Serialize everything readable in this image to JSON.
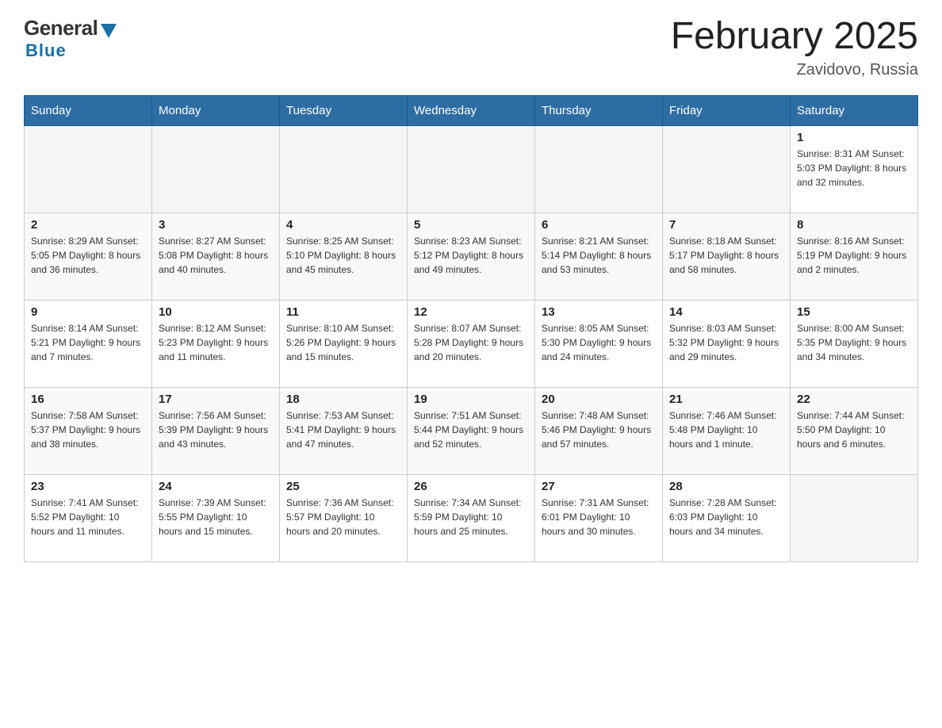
{
  "header": {
    "logo_general": "General",
    "logo_blue": "Blue",
    "month_title": "February 2025",
    "location": "Zavidovo, Russia"
  },
  "weekdays": [
    "Sunday",
    "Monday",
    "Tuesday",
    "Wednesday",
    "Thursday",
    "Friday",
    "Saturday"
  ],
  "weeks": [
    [
      {
        "day": "",
        "info": ""
      },
      {
        "day": "",
        "info": ""
      },
      {
        "day": "",
        "info": ""
      },
      {
        "day": "",
        "info": ""
      },
      {
        "day": "",
        "info": ""
      },
      {
        "day": "",
        "info": ""
      },
      {
        "day": "1",
        "info": "Sunrise: 8:31 AM\nSunset: 5:03 PM\nDaylight: 8 hours and 32 minutes."
      }
    ],
    [
      {
        "day": "2",
        "info": "Sunrise: 8:29 AM\nSunset: 5:05 PM\nDaylight: 8 hours and 36 minutes."
      },
      {
        "day": "3",
        "info": "Sunrise: 8:27 AM\nSunset: 5:08 PM\nDaylight: 8 hours and 40 minutes."
      },
      {
        "day": "4",
        "info": "Sunrise: 8:25 AM\nSunset: 5:10 PM\nDaylight: 8 hours and 45 minutes."
      },
      {
        "day": "5",
        "info": "Sunrise: 8:23 AM\nSunset: 5:12 PM\nDaylight: 8 hours and 49 minutes."
      },
      {
        "day": "6",
        "info": "Sunrise: 8:21 AM\nSunset: 5:14 PM\nDaylight: 8 hours and 53 minutes."
      },
      {
        "day": "7",
        "info": "Sunrise: 8:18 AM\nSunset: 5:17 PM\nDaylight: 8 hours and 58 minutes."
      },
      {
        "day": "8",
        "info": "Sunrise: 8:16 AM\nSunset: 5:19 PM\nDaylight: 9 hours and 2 minutes."
      }
    ],
    [
      {
        "day": "9",
        "info": "Sunrise: 8:14 AM\nSunset: 5:21 PM\nDaylight: 9 hours and 7 minutes."
      },
      {
        "day": "10",
        "info": "Sunrise: 8:12 AM\nSunset: 5:23 PM\nDaylight: 9 hours and 11 minutes."
      },
      {
        "day": "11",
        "info": "Sunrise: 8:10 AM\nSunset: 5:26 PM\nDaylight: 9 hours and 15 minutes."
      },
      {
        "day": "12",
        "info": "Sunrise: 8:07 AM\nSunset: 5:28 PM\nDaylight: 9 hours and 20 minutes."
      },
      {
        "day": "13",
        "info": "Sunrise: 8:05 AM\nSunset: 5:30 PM\nDaylight: 9 hours and 24 minutes."
      },
      {
        "day": "14",
        "info": "Sunrise: 8:03 AM\nSunset: 5:32 PM\nDaylight: 9 hours and 29 minutes."
      },
      {
        "day": "15",
        "info": "Sunrise: 8:00 AM\nSunset: 5:35 PM\nDaylight: 9 hours and 34 minutes."
      }
    ],
    [
      {
        "day": "16",
        "info": "Sunrise: 7:58 AM\nSunset: 5:37 PM\nDaylight: 9 hours and 38 minutes."
      },
      {
        "day": "17",
        "info": "Sunrise: 7:56 AM\nSunset: 5:39 PM\nDaylight: 9 hours and 43 minutes."
      },
      {
        "day": "18",
        "info": "Sunrise: 7:53 AM\nSunset: 5:41 PM\nDaylight: 9 hours and 47 minutes."
      },
      {
        "day": "19",
        "info": "Sunrise: 7:51 AM\nSunset: 5:44 PM\nDaylight: 9 hours and 52 minutes."
      },
      {
        "day": "20",
        "info": "Sunrise: 7:48 AM\nSunset: 5:46 PM\nDaylight: 9 hours and 57 minutes."
      },
      {
        "day": "21",
        "info": "Sunrise: 7:46 AM\nSunset: 5:48 PM\nDaylight: 10 hours and 1 minute."
      },
      {
        "day": "22",
        "info": "Sunrise: 7:44 AM\nSunset: 5:50 PM\nDaylight: 10 hours and 6 minutes."
      }
    ],
    [
      {
        "day": "23",
        "info": "Sunrise: 7:41 AM\nSunset: 5:52 PM\nDaylight: 10 hours and 11 minutes."
      },
      {
        "day": "24",
        "info": "Sunrise: 7:39 AM\nSunset: 5:55 PM\nDaylight: 10 hours and 15 minutes."
      },
      {
        "day": "25",
        "info": "Sunrise: 7:36 AM\nSunset: 5:57 PM\nDaylight: 10 hours and 20 minutes."
      },
      {
        "day": "26",
        "info": "Sunrise: 7:34 AM\nSunset: 5:59 PM\nDaylight: 10 hours and 25 minutes."
      },
      {
        "day": "27",
        "info": "Sunrise: 7:31 AM\nSunset: 6:01 PM\nDaylight: 10 hours and 30 minutes."
      },
      {
        "day": "28",
        "info": "Sunrise: 7:28 AM\nSunset: 6:03 PM\nDaylight: 10 hours and 34 minutes."
      },
      {
        "day": "",
        "info": ""
      }
    ]
  ]
}
